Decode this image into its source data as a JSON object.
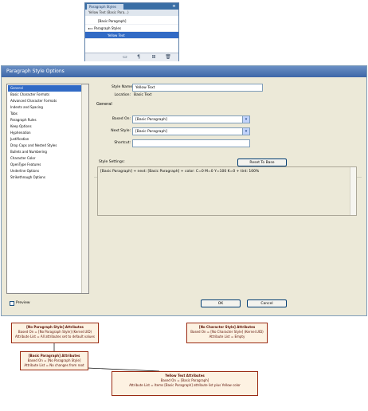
{
  "panel": {
    "tab": "Paragraph Styles",
    "current": "Yellow Text (Basic Para...)",
    "items": [
      {
        "label": "[Basic Paragraph]",
        "indent": 1
      },
      {
        "label": "Paragraph Styles",
        "indent": 0,
        "folder": true
      },
      {
        "label": "Yellow Text",
        "indent": 2,
        "selected": true
      }
    ],
    "bottom_icons": [
      "new-group-icon",
      "clear-overrides-icon",
      "new-style-icon",
      "delete-icon"
    ]
  },
  "dialog": {
    "title": "Paragraph Style Options",
    "categories": [
      "General",
      "Basic Character Formats",
      "Advanced Character Formats",
      "Indents and Spacing",
      "Tabs",
      "Paragraph Rules",
      "Keep Options",
      "Hyphenation",
      "Justification",
      "Drop Caps and Nested Styles",
      "Bullets and Numbering",
      "Character Color",
      "OpenType Features",
      "Underline Options",
      "Strikethrough Options"
    ],
    "style_name_label": "Style Name:",
    "style_name_value": "Yellow Text",
    "location_label": "Location:",
    "location_value": "Basic Text",
    "general_label": "General",
    "based_on_label": "Based On:",
    "based_on_value": "[Basic Paragraph]",
    "next_style_label": "Next Style:",
    "next_style_value": "[Basic Paragraph]",
    "shortcut_label": "Shortcut:",
    "shortcut_value": "",
    "settings_label": "Style Settings:",
    "reset_button": "Reset To Base",
    "settings_text": "[Basic Paragraph] + next: [Basic Paragraph] + color: C=0 M=0 Y=100 K=0 + tint: 100%",
    "preview_label": "Preview",
    "ok_button": "OK",
    "cancel_button": "Cancel"
  },
  "notes": {
    "no_para": {
      "title": "[No Paragraph Style] Attributes",
      "line1": "Based On = [No Paragraph Style] (Kernel.UID)",
      "line2": "Attribute List = All attributes set to default values"
    },
    "basic_para": {
      "title": "[Basic Paragraph] Attributes",
      "line1": "Based On = [No Paragraph Style]",
      "line2": "Attribute List = No changes from root"
    },
    "no_char": {
      "title": "[No Character Style] Attributes",
      "line1": "Based On = [No Character Style] (Kernel.UID)",
      "line2": "Attribute List = Empty"
    },
    "yellow": {
      "title": "Yellow Text Attributes",
      "line1": "Based On = [Basic Paragraph]",
      "line2": "Attribute List = Items [Basic Paragraph] attribute list plus Yellow color"
    }
  },
  "colors": {
    "selection": "#316ac5",
    "title_bar": "#3d67a8",
    "note_border": "#9a2a12",
    "note_fill": "#fdf2e2"
  }
}
